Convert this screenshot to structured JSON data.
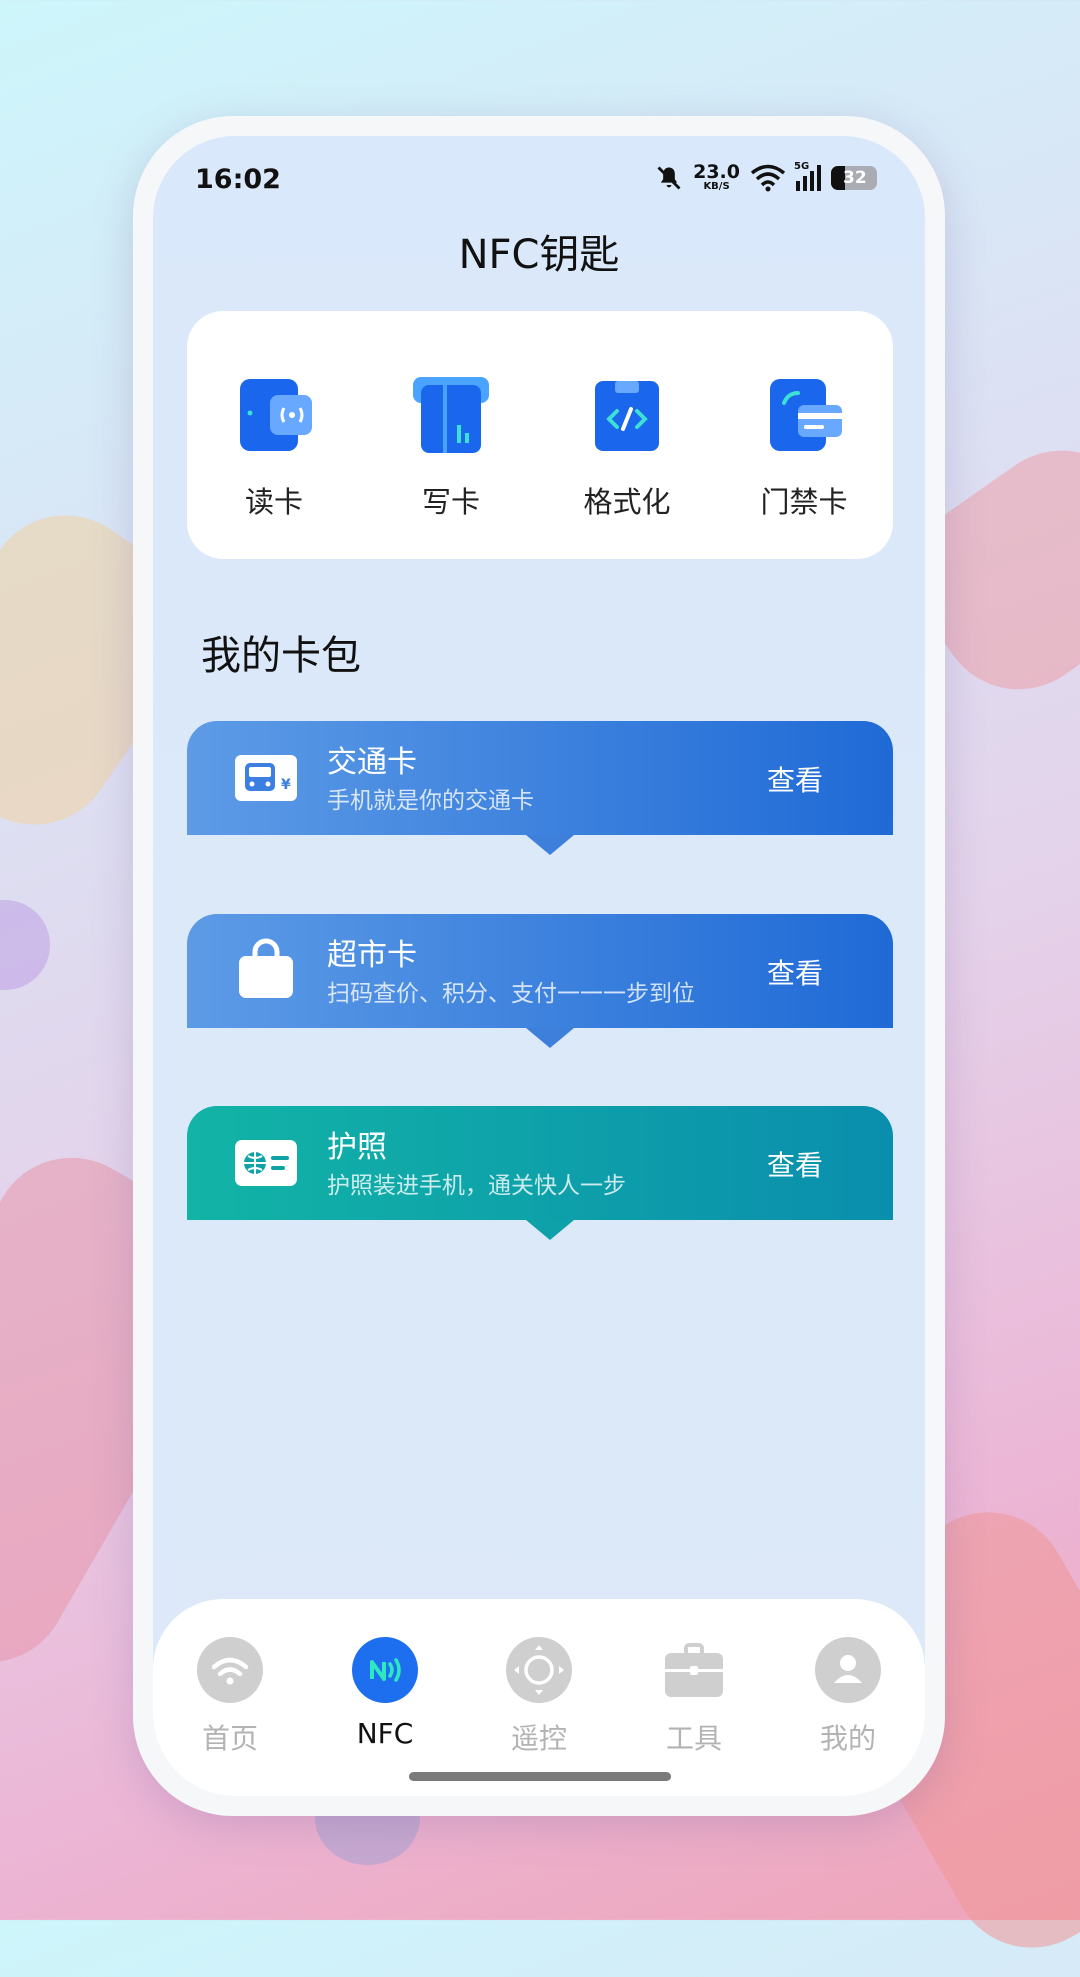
{
  "status": {
    "time": "16:02",
    "net_speed": "23.0",
    "net_unit": "KB/S",
    "net_type": "5G",
    "battery": "32"
  },
  "page": {
    "title": "NFC钥匙"
  },
  "quick_actions": [
    {
      "label": "读卡",
      "icon": "read-card-icon"
    },
    {
      "label": "写卡",
      "icon": "write-card-icon"
    },
    {
      "label": "格式化",
      "icon": "format-icon"
    },
    {
      "label": "门禁卡",
      "icon": "access-card-icon"
    }
  ],
  "wallet": {
    "title": "我的卡包",
    "cards": [
      {
        "name": "交通卡",
        "desc": "手机就是你的交通卡",
        "action": "查看",
        "icon": "bus-card-icon",
        "color_from": "#5d9be6",
        "color_to": "#1f6ad6"
      },
      {
        "name": "超市卡",
        "desc": "扫码查价、积分、支付一一一步到位",
        "action": "查看",
        "icon": "shopping-bag-icon",
        "color_from": "#5d9be6",
        "color_to": "#1f6ad6"
      },
      {
        "name": "护照",
        "desc": "护照装进手机，通关快人一步",
        "action": "查看",
        "icon": "passport-icon",
        "color_from": "#12b4a6",
        "color_to": "#0a8ead"
      }
    ]
  },
  "tabbar": {
    "items": [
      {
        "label": "首页",
        "icon": "wifi-icon",
        "active": false
      },
      {
        "label": "NFC",
        "icon": "nfc-icon",
        "active": true
      },
      {
        "label": "遥控",
        "icon": "remote-icon",
        "active": false
      },
      {
        "label": "工具",
        "icon": "toolbox-icon",
        "active": false
      },
      {
        "label": "我的",
        "icon": "user-icon",
        "active": false
      }
    ]
  },
  "colors": {
    "accent": "#1f6ad6",
    "nfc_active": "#1d6ff0",
    "nfc_signal": "#2ee8c0"
  }
}
